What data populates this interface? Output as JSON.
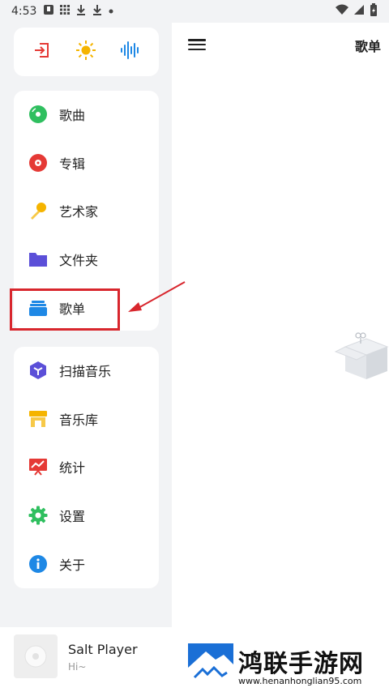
{
  "status_bar": {
    "time": "4:53",
    "left_icons": [
      "app-icon",
      "grid-icon",
      "download-icon",
      "download-icon",
      "dot-icon"
    ],
    "right_icons": [
      "wifi-icon",
      "signal-icon",
      "battery-icon"
    ]
  },
  "main": {
    "title": "歌单",
    "menu_icon": "hamburger-icon"
  },
  "quick_actions": [
    {
      "name": "exit-icon",
      "color": "#e53935"
    },
    {
      "name": "sun-icon",
      "color": "#f5b400"
    },
    {
      "name": "waveform-icon",
      "color": "#1e88e5"
    }
  ],
  "library": {
    "items": [
      {
        "label": "歌曲",
        "icon": "music-disc-icon",
        "color": "#2fbf5f"
      },
      {
        "label": "专辑",
        "icon": "album-icon",
        "color": "#e53935"
      },
      {
        "label": "艺术家",
        "icon": "microphone-icon",
        "color": "#f5b400"
      },
      {
        "label": "文件夹",
        "icon": "folder-icon",
        "color": "#5b4fd8"
      },
      {
        "label": "歌单",
        "icon": "playlist-icon",
        "color": "#1e88e5"
      }
    ]
  },
  "tools": {
    "items": [
      {
        "label": "扫描音乐",
        "icon": "scan-icon",
        "color": "#5b4fd8"
      },
      {
        "label": "音乐库",
        "icon": "store-icon",
        "color": "#f5b400"
      },
      {
        "label": "统计",
        "icon": "chart-icon",
        "color": "#e53935"
      },
      {
        "label": "设置",
        "icon": "gear-icon",
        "color": "#2fbf5f"
      },
      {
        "label": "关于",
        "icon": "info-icon",
        "color": "#1e88e5"
      }
    ]
  },
  "player": {
    "title": "Salt Player",
    "subtitle": "Hi~"
  },
  "watermark": {
    "text": "鸿联手游网",
    "url": "www.henanhonglian95.com"
  },
  "annotation": {
    "highlight_color": "#d8262d"
  }
}
